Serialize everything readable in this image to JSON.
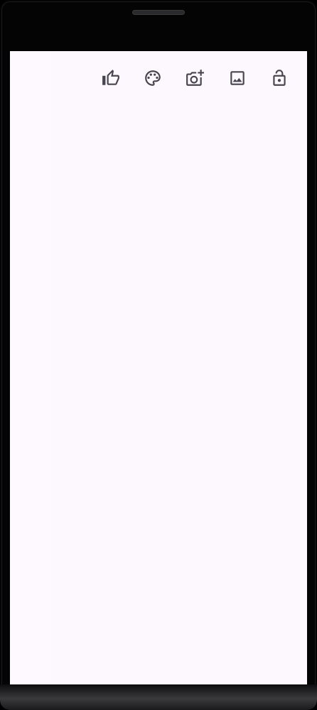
{
  "toolbar": {
    "icons": [
      {
        "name": "thumb-up-icon"
      },
      {
        "name": "palette-icon"
      },
      {
        "name": "add-photo-icon"
      },
      {
        "name": "image-icon"
      },
      {
        "name": "lock-open-icon"
      }
    ]
  },
  "colors": {
    "icon": "#49454f",
    "screen_background": "#fcf8fd",
    "device_frame": "#050405"
  }
}
